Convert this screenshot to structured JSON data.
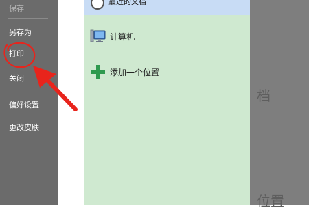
{
  "menu": {
    "items": [
      {
        "label": "保存",
        "dim": true
      },
      {
        "label": "另存为"
      },
      {
        "label": "打印"
      },
      {
        "label": "关闭"
      },
      {
        "label": "偏好设置"
      },
      {
        "label": "更改皮肤"
      }
    ]
  },
  "places": {
    "recent_label": "最近的文档",
    "computer_label": "计算机",
    "add_location_label": "添加一个位置"
  },
  "background": {
    "ghost_text_1": "档",
    "ghost_text_2": "位置"
  },
  "colors": {
    "menu_bg": "#6b6b6b",
    "panel_bg": "#cfe9d0",
    "selected_bg": "#c8dcf5",
    "add_icon": "#2f9a4f",
    "annotation_red": "#e8241c"
  }
}
